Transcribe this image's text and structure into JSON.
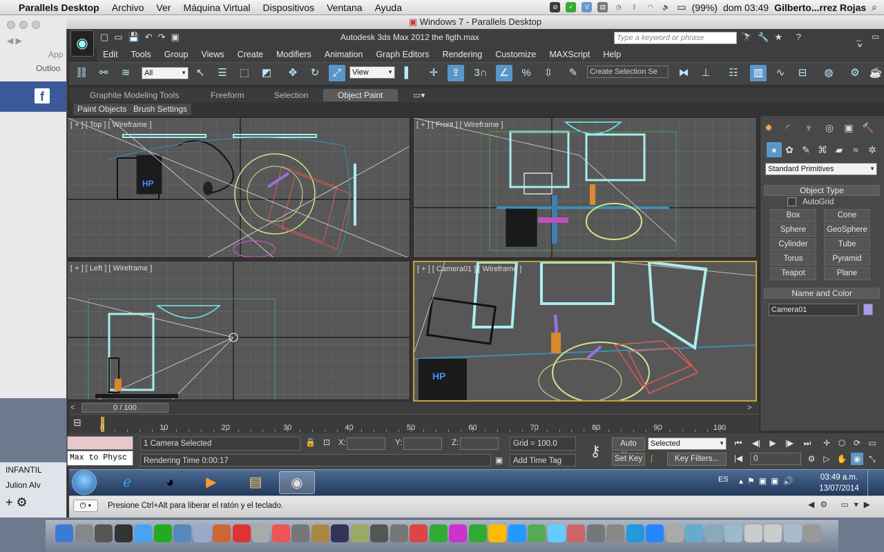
{
  "mac_menubar": {
    "app": "Parallels Desktop",
    "items": [
      "Archivo",
      "Ver",
      "Máquina Virtual",
      "Dispositivos",
      "Ventana",
      "Ayuda"
    ],
    "battery": "(99%)",
    "clock": "dom 03:49",
    "user": "Gilberto...rrez Rojas"
  },
  "behind_window": {
    "app_label": "App",
    "outlook_label": "Outloo",
    "items": [
      "INFANTIL",
      "Julion Alv"
    ]
  },
  "parallels": {
    "title": "Windows 7 - Parallels Desktop",
    "status_message": "Presione Ctrl+Alt para liberar el ratón y el teclado."
  },
  "max": {
    "title": "Autodesk 3ds Max  2012     the figth.max",
    "search_placeholder": "Type a keyword or phrase",
    "menus": [
      "Edit",
      "Tools",
      "Group",
      "Views",
      "Create",
      "Modifiers",
      "Animation",
      "Graph Editors",
      "Rendering",
      "Customize",
      "MAXScript",
      "Help"
    ],
    "toolbar": {
      "selection_filter": "All",
      "ref_coord": "View",
      "snap_3": "3",
      "named_selection": "Create Selection Se"
    },
    "ribbon_tabs": [
      "Graphite Modeling Tools",
      "Freeform",
      "Selection",
      "Object Paint"
    ],
    "ribbon_sub": [
      "Paint Objects",
      "Brush Settings"
    ],
    "viewports": {
      "top": "[ + ] [ Top ] [ Wireframe ]",
      "front": "[ + ] [ Front ] [ Wireframe ]",
      "left": "[ + ] [ Left ] [ Wireframe ]",
      "camera": "[ + ] [ Camera01 ] [ Wireframe ]"
    },
    "command_panel": {
      "category": "Standard Primitives",
      "object_type_title": "Object Type",
      "autogrid": "AutoGrid",
      "primitives": [
        "Box",
        "Cone",
        "Sphere",
        "GeoSphere",
        "Cylinder",
        "Tube",
        "Torus",
        "Pyramid",
        "Teapot",
        "Plane"
      ],
      "name_color_title": "Name and Color",
      "object_name": "Camera01",
      "object_color": "#a89de8"
    },
    "timeline": {
      "slider": "0 / 100",
      "ticks": [
        "0",
        "10",
        "20",
        "30",
        "40",
        "50",
        "60",
        "70",
        "80",
        "90",
        "100"
      ]
    },
    "status": {
      "script_box": "Max to Physc",
      "selection": "1 Camera Selected",
      "render_time": "Rendering Time  0:00:17",
      "x_label": "X:",
      "y_label": "Y:",
      "z_label": "Z:",
      "grid": "Grid = 100.0",
      "add_time_tag": "Add Time Tag",
      "auto_key": "Auto Key",
      "set_key": "Set Key",
      "key_mode": "Selected",
      "key_filters": "Key Filters...",
      "frame": "0"
    }
  },
  "win_taskbar": {
    "lang": "ES",
    "time": "03:49 a.m.",
    "date": "13/07/2014"
  },
  "colors": {
    "viewport_bg": "#575757",
    "active_border": "#c8a23c",
    "highlight_blue": "#5a96c8"
  }
}
